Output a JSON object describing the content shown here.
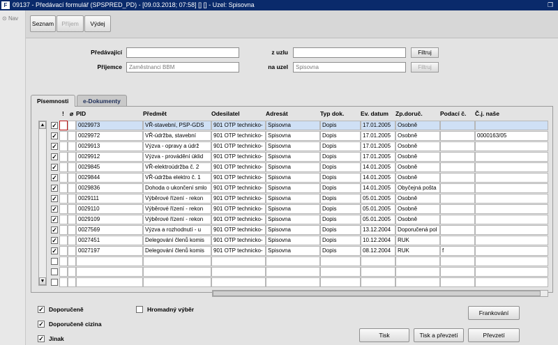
{
  "window": {
    "title": "09137 - Předávací formulář (SPSPRED_PD) - [09.03.2018; 07:58] [] [] - Uzel: Spisovna",
    "app_icon": "F",
    "restore_icon": "restore-icon"
  },
  "nav": {
    "label": "Nav"
  },
  "toolbar": {
    "seznam": "Seznam",
    "prijem": "Příjem",
    "vydej": "Výdej"
  },
  "form": {
    "predavajici_label": "Předávající",
    "predavajici_value": "",
    "z_uzlu_label": "z uzlu",
    "z_uzlu_value": "",
    "filtruj1": "Filtruj",
    "prijemce_label": "Příjemce",
    "prijemce_value": "Zaměstnanci BBM",
    "na_uzel_label": "na uzel",
    "na_uzel_value": "Spisovna",
    "filtruj2": "Filtruj"
  },
  "tabs": [
    "Písemnosti",
    "e-Dokumenty"
  ],
  "grid": {
    "columns": [
      "!",
      "PID",
      "Předmět",
      "Odesilatel",
      "Adresát",
      "Typ dok.",
      "Ev. datum",
      "Zp.doruč.",
      "Podací č.",
      "Č.j. naše"
    ],
    "rows": [
      {
        "checked": true,
        "pid": "0029973",
        "predmet": "VŘ-stavební, PSP-GDS",
        "odesilatel": "901 OTP technicko-",
        "adresat": "Spisovna",
        "typ": "Dopis",
        "datum": "17.01.2005",
        "zp": "Osobně",
        "podaci": "",
        "cj": ""
      },
      {
        "checked": true,
        "pid": "0029972",
        "predmet": "VŘ-údržba, stavební",
        "odesilatel": "901 OTP technicko-",
        "adresat": "Spisovna",
        "typ": "Dopis",
        "datum": "17.01.2005",
        "zp": "Osobně",
        "podaci": "",
        "cj": "0000163/05"
      },
      {
        "checked": true,
        "pid": "0029913",
        "predmet": "Výzva - opravy a údrž",
        "odesilatel": "901 OTP technicko-",
        "adresat": "Spisovna",
        "typ": "Dopis",
        "datum": "17.01.2005",
        "zp": "Osobně",
        "podaci": "",
        "cj": ""
      },
      {
        "checked": true,
        "pid": "0029912",
        "predmet": "Výzva - provádění úklid",
        "odesilatel": "901 OTP technicko-",
        "adresat": "Spisovna",
        "typ": "Dopis",
        "datum": "17.01.2005",
        "zp": "Osobně",
        "podaci": "",
        "cj": ""
      },
      {
        "checked": true,
        "pid": "0029845",
        "predmet": "VŘ-elektroúdržba č. 2",
        "odesilatel": "901 OTP technicko-",
        "adresat": "Spisovna",
        "typ": "Dopis",
        "datum": "14.01.2005",
        "zp": "Osobně",
        "podaci": "",
        "cj": ""
      },
      {
        "checked": true,
        "pid": "0029844",
        "predmet": "VŘ-údržba elektro č. 1",
        "odesilatel": "901 OTP technicko-",
        "adresat": "Spisovna",
        "typ": "Dopis",
        "datum": "14.01.2005",
        "zp": "Osobně",
        "podaci": "",
        "cj": ""
      },
      {
        "checked": true,
        "pid": "0029836",
        "predmet": "Dohoda o ukončení smlo",
        "odesilatel": "901 OTP technicko-",
        "adresat": "Spisovna",
        "typ": "Dopis",
        "datum": "14.01.2005",
        "zp": "Obyčejná pošta",
        "podaci": "",
        "cj": ""
      },
      {
        "checked": true,
        "pid": "0029111",
        "predmet": "Výběrové řízení - rekon",
        "odesilatel": "901 OTP technicko-",
        "adresat": "Spisovna",
        "typ": "Dopis",
        "datum": "05.01.2005",
        "zp": "Osobně",
        "podaci": "",
        "cj": ""
      },
      {
        "checked": true,
        "pid": "0029110",
        "predmet": "Výběrové řízení - rekon",
        "odesilatel": "901 OTP technicko-",
        "adresat": "Spisovna",
        "typ": "Dopis",
        "datum": "05.01.2005",
        "zp": "Osobně",
        "podaci": "",
        "cj": ""
      },
      {
        "checked": true,
        "pid": "0029109",
        "predmet": "Výběrové řízení - rekon",
        "odesilatel": "901 OTP technicko-",
        "adresat": "Spisovna",
        "typ": "Dopis",
        "datum": "05.01.2005",
        "zp": "Osobně",
        "podaci": "",
        "cj": ""
      },
      {
        "checked": true,
        "pid": "0027569",
        "predmet": "Výzva a rozhodnutí - u",
        "odesilatel": "901 OTP technicko-",
        "adresat": "Spisovna",
        "typ": "Dopis",
        "datum": "13.12.2004",
        "zp": "Doporučená pol",
        "podaci": "",
        "cj": ""
      },
      {
        "checked": true,
        "pid": "0027451",
        "predmet": "Delegování členů komis",
        "odesilatel": "901 OTP technicko-",
        "adresat": "Spisovna",
        "typ": "Dopis",
        "datum": "10.12.2004",
        "zp": "RUK",
        "podaci": "",
        "cj": ""
      },
      {
        "checked": true,
        "pid": "0027197",
        "predmet": "Delegování členů komis",
        "odesilatel": "901 OTP technicko-",
        "adresat": "Spisovna",
        "typ": "Dopis",
        "datum": "08.12.2004",
        "zp": "RUK",
        "podaci": "f",
        "cj": ""
      },
      {
        "checked": false,
        "pid": "",
        "predmet": "",
        "odesilatel": "",
        "adresat": "",
        "typ": "",
        "datum": "",
        "zp": "",
        "podaci": "",
        "cj": ""
      },
      {
        "checked": false,
        "pid": "",
        "predmet": "",
        "odesilatel": "",
        "adresat": "",
        "typ": "",
        "datum": "",
        "zp": "",
        "podaci": "",
        "cj": ""
      },
      {
        "checked": false,
        "pid": "",
        "predmet": "",
        "odesilatel": "",
        "adresat": "",
        "typ": "",
        "datum": "",
        "zp": "",
        "podaci": "",
        "cj": ""
      }
    ]
  },
  "options": {
    "doporucene": {
      "label": "Doporučeně",
      "checked": true
    },
    "doporucene_cizina": {
      "label": "Doporučeně cizina",
      "checked": true
    },
    "jinak": {
      "label": "Jinak",
      "checked": true
    },
    "hromadny_vyber": {
      "label": "Hromadný výběr",
      "checked": false
    }
  },
  "buttons": {
    "frankovani": "Frankování",
    "tisk": "Tisk",
    "tisk_a_prevzeti": "Tisk a převzetí",
    "prevzeti": "Převzetí"
  }
}
